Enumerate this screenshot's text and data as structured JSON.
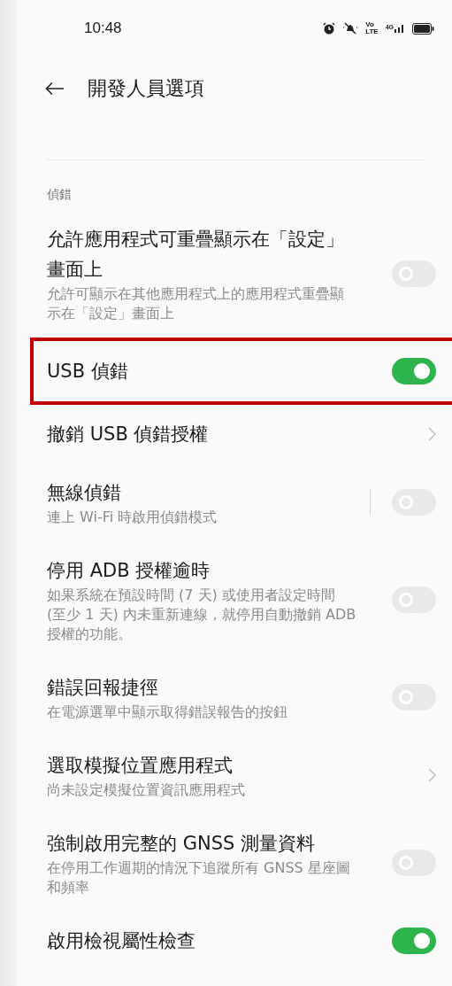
{
  "status_bar": {
    "time": "10:48",
    "volte": [
      "Vo",
      "LTE"
    ],
    "network": "4G"
  },
  "header": {
    "title": "開發人員選項"
  },
  "section": {
    "label": "偵錯"
  },
  "items": [
    {
      "kind": "toggle",
      "title": "允許應用程式可重疊顯示在「設定」畫面上",
      "description": "允許可顯示在其他應用程式上的應用程式重疊顯示在「設定」畫面上",
      "on": false,
      "highlighted": false
    },
    {
      "kind": "toggle",
      "title": "USB 偵錯",
      "on": true,
      "highlighted": true
    },
    {
      "kind": "link",
      "title": "撤銷 USB 偵錯授權",
      "highlighted": false
    },
    {
      "kind": "split-toggle",
      "title": "無線偵錯",
      "description": "連上 Wi-Fi 時啟用偵錯模式",
      "on": false,
      "highlighted": false
    },
    {
      "kind": "toggle",
      "title": "停用 ADB 授權逾時",
      "description": "如果系統在預設時間 (7 天) 或使用者設定時間 (至少 1 天) 內未重新連線，就停用自動撤銷 ADB 授權的功能。",
      "on": false,
      "highlighted": false
    },
    {
      "kind": "toggle",
      "title": "錯誤回報捷徑",
      "description": "在電源選單中顯示取得錯誤報告的按鈕",
      "on": false,
      "highlighted": false
    },
    {
      "kind": "link",
      "title": "選取模擬位置應用程式",
      "description": "尚未設定模擬位置資訊應用程式",
      "highlighted": false
    },
    {
      "kind": "toggle",
      "title": "強制啟用完整的 GNSS 測量資料",
      "description": "在停用工作週期的情況下追蹤所有 GNSS 星座圖和頻率",
      "on": false,
      "highlighted": false
    },
    {
      "kind": "toggle",
      "title": "啟用檢視屬性檢查",
      "on": true,
      "highlighted": false
    }
  ]
}
